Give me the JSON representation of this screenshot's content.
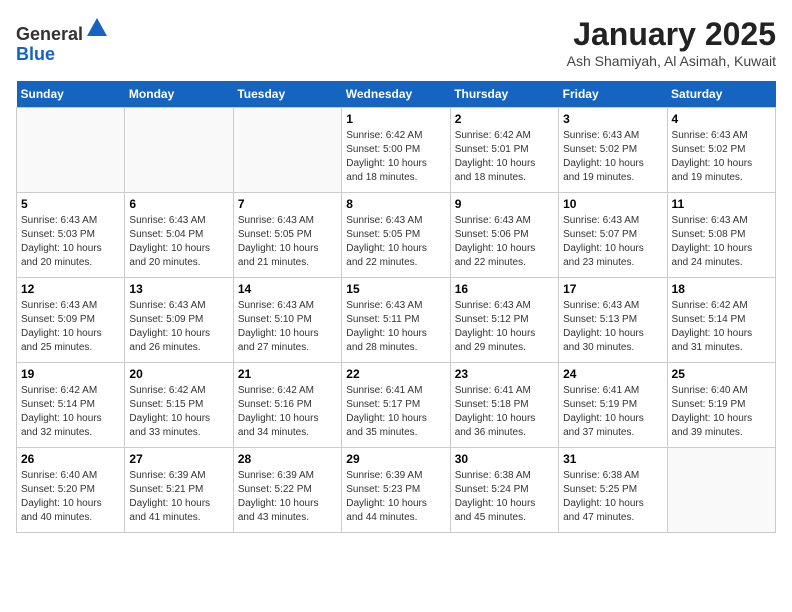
{
  "header": {
    "logo_line1": "General",
    "logo_line2": "Blue",
    "title": "January 2025",
    "subtitle": "Ash Shamiyah, Al Asimah, Kuwait"
  },
  "weekdays": [
    "Sunday",
    "Monday",
    "Tuesday",
    "Wednesday",
    "Thursday",
    "Friday",
    "Saturday"
  ],
  "weeks": [
    [
      {
        "day": "",
        "info": ""
      },
      {
        "day": "",
        "info": ""
      },
      {
        "day": "",
        "info": ""
      },
      {
        "day": "1",
        "info": "Sunrise: 6:42 AM\nSunset: 5:00 PM\nDaylight: 10 hours\nand 18 minutes."
      },
      {
        "day": "2",
        "info": "Sunrise: 6:42 AM\nSunset: 5:01 PM\nDaylight: 10 hours\nand 18 minutes."
      },
      {
        "day": "3",
        "info": "Sunrise: 6:43 AM\nSunset: 5:02 PM\nDaylight: 10 hours\nand 19 minutes."
      },
      {
        "day": "4",
        "info": "Sunrise: 6:43 AM\nSunset: 5:02 PM\nDaylight: 10 hours\nand 19 minutes."
      }
    ],
    [
      {
        "day": "5",
        "info": "Sunrise: 6:43 AM\nSunset: 5:03 PM\nDaylight: 10 hours\nand 20 minutes."
      },
      {
        "day": "6",
        "info": "Sunrise: 6:43 AM\nSunset: 5:04 PM\nDaylight: 10 hours\nand 20 minutes."
      },
      {
        "day": "7",
        "info": "Sunrise: 6:43 AM\nSunset: 5:05 PM\nDaylight: 10 hours\nand 21 minutes."
      },
      {
        "day": "8",
        "info": "Sunrise: 6:43 AM\nSunset: 5:05 PM\nDaylight: 10 hours\nand 22 minutes."
      },
      {
        "day": "9",
        "info": "Sunrise: 6:43 AM\nSunset: 5:06 PM\nDaylight: 10 hours\nand 22 minutes."
      },
      {
        "day": "10",
        "info": "Sunrise: 6:43 AM\nSunset: 5:07 PM\nDaylight: 10 hours\nand 23 minutes."
      },
      {
        "day": "11",
        "info": "Sunrise: 6:43 AM\nSunset: 5:08 PM\nDaylight: 10 hours\nand 24 minutes."
      }
    ],
    [
      {
        "day": "12",
        "info": "Sunrise: 6:43 AM\nSunset: 5:09 PM\nDaylight: 10 hours\nand 25 minutes."
      },
      {
        "day": "13",
        "info": "Sunrise: 6:43 AM\nSunset: 5:09 PM\nDaylight: 10 hours\nand 26 minutes."
      },
      {
        "day": "14",
        "info": "Sunrise: 6:43 AM\nSunset: 5:10 PM\nDaylight: 10 hours\nand 27 minutes."
      },
      {
        "day": "15",
        "info": "Sunrise: 6:43 AM\nSunset: 5:11 PM\nDaylight: 10 hours\nand 28 minutes."
      },
      {
        "day": "16",
        "info": "Sunrise: 6:43 AM\nSunset: 5:12 PM\nDaylight: 10 hours\nand 29 minutes."
      },
      {
        "day": "17",
        "info": "Sunrise: 6:43 AM\nSunset: 5:13 PM\nDaylight: 10 hours\nand 30 minutes."
      },
      {
        "day": "18",
        "info": "Sunrise: 6:42 AM\nSunset: 5:14 PM\nDaylight: 10 hours\nand 31 minutes."
      }
    ],
    [
      {
        "day": "19",
        "info": "Sunrise: 6:42 AM\nSunset: 5:14 PM\nDaylight: 10 hours\nand 32 minutes."
      },
      {
        "day": "20",
        "info": "Sunrise: 6:42 AM\nSunset: 5:15 PM\nDaylight: 10 hours\nand 33 minutes."
      },
      {
        "day": "21",
        "info": "Sunrise: 6:42 AM\nSunset: 5:16 PM\nDaylight: 10 hours\nand 34 minutes."
      },
      {
        "day": "22",
        "info": "Sunrise: 6:41 AM\nSunset: 5:17 PM\nDaylight: 10 hours\nand 35 minutes."
      },
      {
        "day": "23",
        "info": "Sunrise: 6:41 AM\nSunset: 5:18 PM\nDaylight: 10 hours\nand 36 minutes."
      },
      {
        "day": "24",
        "info": "Sunrise: 6:41 AM\nSunset: 5:19 PM\nDaylight: 10 hours\nand 37 minutes."
      },
      {
        "day": "25",
        "info": "Sunrise: 6:40 AM\nSunset: 5:19 PM\nDaylight: 10 hours\nand 39 minutes."
      }
    ],
    [
      {
        "day": "26",
        "info": "Sunrise: 6:40 AM\nSunset: 5:20 PM\nDaylight: 10 hours\nand 40 minutes."
      },
      {
        "day": "27",
        "info": "Sunrise: 6:39 AM\nSunset: 5:21 PM\nDaylight: 10 hours\nand 41 minutes."
      },
      {
        "day": "28",
        "info": "Sunrise: 6:39 AM\nSunset: 5:22 PM\nDaylight: 10 hours\nand 43 minutes."
      },
      {
        "day": "29",
        "info": "Sunrise: 6:39 AM\nSunset: 5:23 PM\nDaylight: 10 hours\nand 44 minutes."
      },
      {
        "day": "30",
        "info": "Sunrise: 6:38 AM\nSunset: 5:24 PM\nDaylight: 10 hours\nand 45 minutes."
      },
      {
        "day": "31",
        "info": "Sunrise: 6:38 AM\nSunset: 5:25 PM\nDaylight: 10 hours\nand 47 minutes."
      },
      {
        "day": "",
        "info": ""
      }
    ]
  ]
}
